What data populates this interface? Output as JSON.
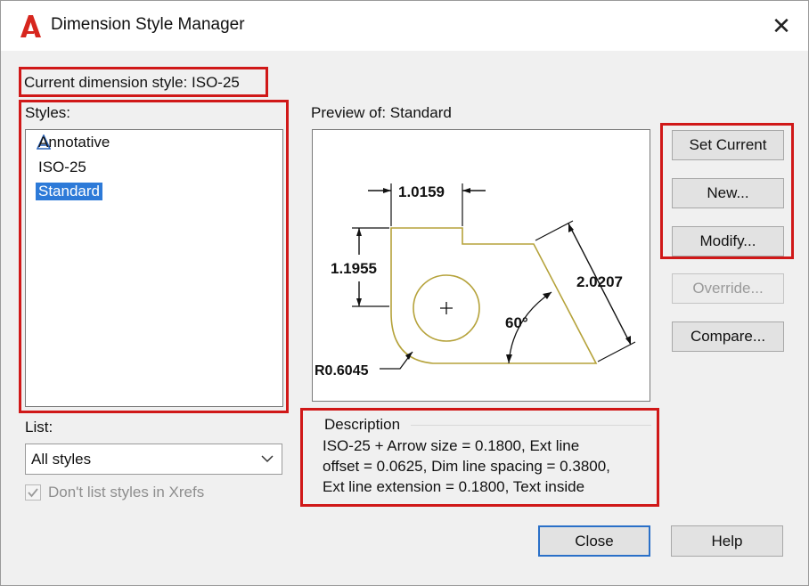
{
  "window": {
    "title": "Dimension Style Manager"
  },
  "current_style": {
    "label": "Current dimension style: ISO-25"
  },
  "styles": {
    "label": "Styles:",
    "items": [
      {
        "label": "Annotative",
        "icon": "annotative-icon"
      },
      {
        "label": "ISO-25"
      },
      {
        "label": "Standard",
        "selected": true
      }
    ]
  },
  "list": {
    "label": "List:",
    "selected": "All styles"
  },
  "xrefs_checkbox": {
    "label": "Don't list styles in Xrefs",
    "checked": true
  },
  "preview": {
    "label": "Preview of: Standard",
    "dims": {
      "horizontal": "1.0159",
      "vertical": "1.1955",
      "aligned": "2.0207",
      "angle": "60°",
      "radius": "R0.6045"
    }
  },
  "buttons": {
    "set_current": "Set Current",
    "new": "New...",
    "modify": "Modify...",
    "override": "Override...",
    "compare": "Compare...",
    "close": "Close",
    "help": "Help"
  },
  "description": {
    "title": "Description",
    "lines": [
      "ISO-25 + Arrow size = 0.1800, Ext line",
      "offset = 0.0625, Dim line spacing = 0.3800,",
      "Ext line extension = 0.1800, Text inside"
    ]
  },
  "colors": {
    "highlight_box": "#d01818",
    "selection": "#2d7ad8",
    "drawing_outline": "#b5a23a"
  }
}
